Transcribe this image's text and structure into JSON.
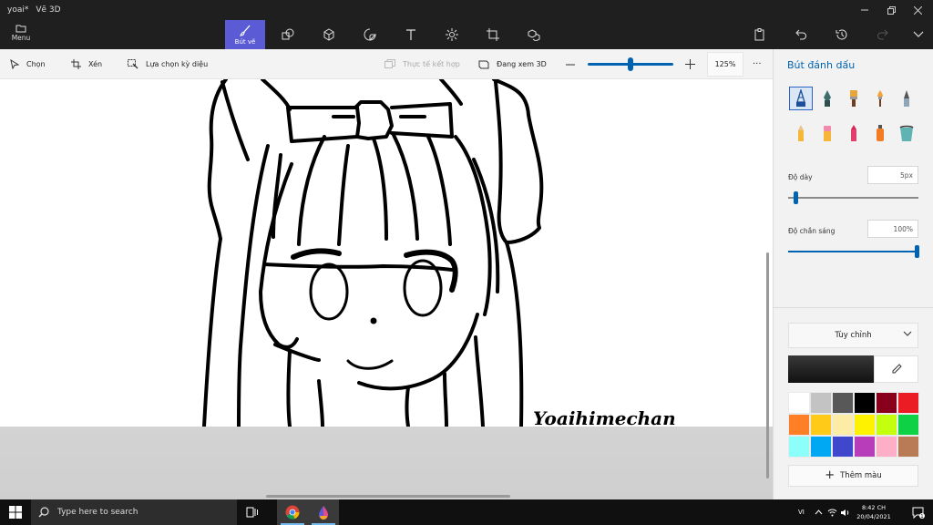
{
  "window": {
    "file_name": "yoai*",
    "app_name": "Vẽ 3D"
  },
  "ribbon": {
    "menu_label": "Menu",
    "active_tool_label": "Bút vẽ"
  },
  "toolbar": {
    "select_label": "Chọn",
    "crop_label": "Xén",
    "magic_select_label": "Lựa chọn kỳ diệu",
    "mixed_reality_label": "Thực tế kết hợp",
    "view_3d_label": "Đang xem 3D",
    "zoom_value": "125%",
    "zoom_level_percent": 125,
    "more_label": "···"
  },
  "canvas": {
    "signature_text": "Yoaihimechan"
  },
  "panel": {
    "title": "Bút đánh dấu",
    "brushes": [
      "marker",
      "calligraphy-pen",
      "oil-brush",
      "watercolor",
      "pixel-pen",
      "pencil",
      "eraser",
      "crayon",
      "spray-can",
      "fill"
    ],
    "selected_brush": "marker",
    "thickness_label": "Độ dày",
    "thickness_value": "5px",
    "opacity_label": "Độ chắn sáng",
    "opacity_value": "100%",
    "opacity_percent": 100,
    "custom_label": "Tùy chỉnh",
    "add_color_label": "Thêm màu",
    "current_color": "#1a1a1a",
    "swatches": [
      "#ffffff",
      "#c3c3c3",
      "#585858",
      "#000000",
      "#88001b",
      "#ec1c24",
      "#ff7f27",
      "#ffca18",
      "#fdeca6",
      "#fff200",
      "#c4ff0e",
      "#0ed145",
      "#8cfffb",
      "#00a8f3",
      "#3f48cc",
      "#b83dba",
      "#ffaec8",
      "#b97a56"
    ]
  },
  "taskbar": {
    "search_placeholder": "Type here to search",
    "language": "VI",
    "time": "8:42 CH",
    "date": "20/04/2021",
    "notification_count": "1"
  },
  "colors": {
    "accent": "#0063b1",
    "active_tool": "#5b5bd6"
  }
}
